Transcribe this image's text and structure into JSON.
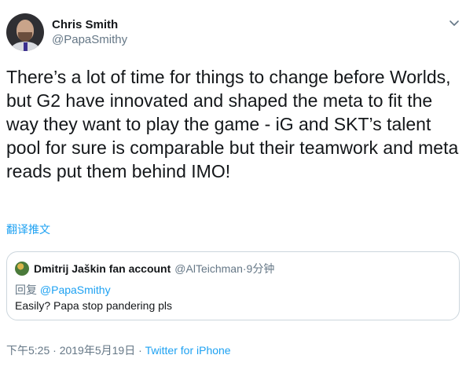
{
  "author": {
    "display_name": "Chris Smith",
    "handle": "@PapaSmithy"
  },
  "tweet": {
    "text": "There’s a lot of time for things to change before Worlds, but G2 have innovated and shaped the meta to fit the way they want to play the game - iG and SKT’s talent pool for sure is comparable but their teamwork and meta reads put them behind IMO!",
    "translate_label": "翻译推文"
  },
  "quoted_tweet": {
    "display_name": "Dmitrij Jaškin fan account",
    "handle": "@AlTeichman",
    "separator": "·",
    "time_ago": "9分钟",
    "reply_prefix": "回复",
    "reply_to": "@PapaSmithy",
    "text": "Easily? Papa stop pandering pls"
  },
  "footer": {
    "timestamp": "下午5:25 · 2019年5月19日",
    "separator": "·",
    "source": "Twitter for iPhone"
  },
  "icons": {
    "menu": "chevron-down-icon"
  },
  "colors": {
    "link": "#1da1f2",
    "secondary_text": "#657786",
    "border": "#ccd6dd"
  }
}
